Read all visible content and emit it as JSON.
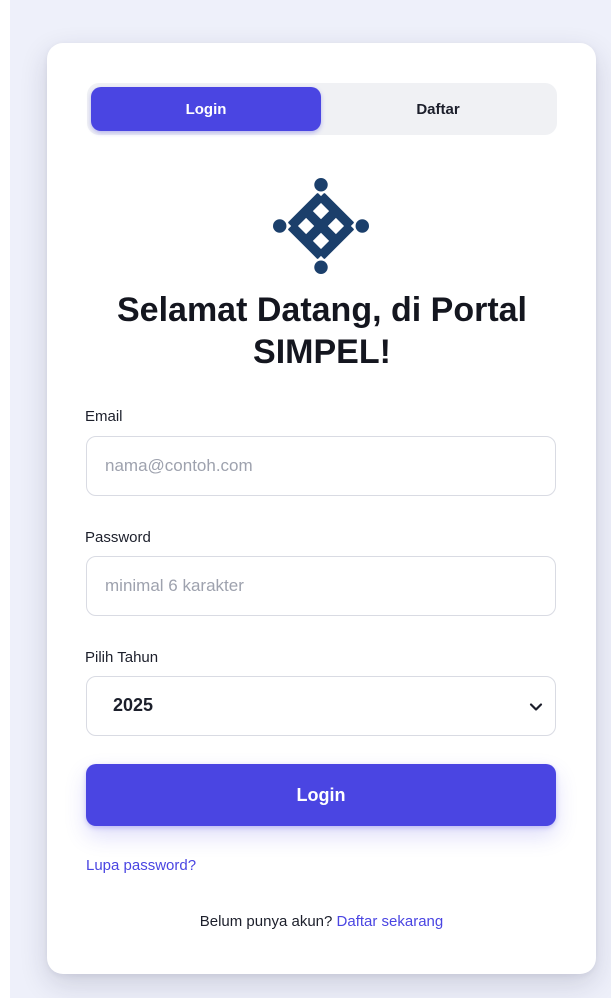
{
  "tabs": {
    "login_label": "Login",
    "register_label": "Daftar",
    "active": "login"
  },
  "logo": {
    "icon": "kemnaker-emblem-icon",
    "color": "#1b3f6b"
  },
  "title": {
    "line1": "Selamat Datang, di Portal",
    "line2": "SIMPEL!"
  },
  "form": {
    "email": {
      "label": "Email",
      "placeholder": "nama@contoh.com",
      "value": ""
    },
    "password": {
      "label": "Password",
      "placeholder": "minimal 6 karakter",
      "value": ""
    },
    "year": {
      "label": "Pilih Tahun",
      "selected": "2025"
    },
    "submit_label": "Login"
  },
  "links": {
    "forgot_password": "Lupa password?",
    "register_prompt": "Belum punya akun?",
    "register_link": "Daftar sekarang"
  },
  "colors": {
    "accent": "#4a45e2",
    "background": "#eef0fa",
    "logo": "#1b3f6b"
  }
}
